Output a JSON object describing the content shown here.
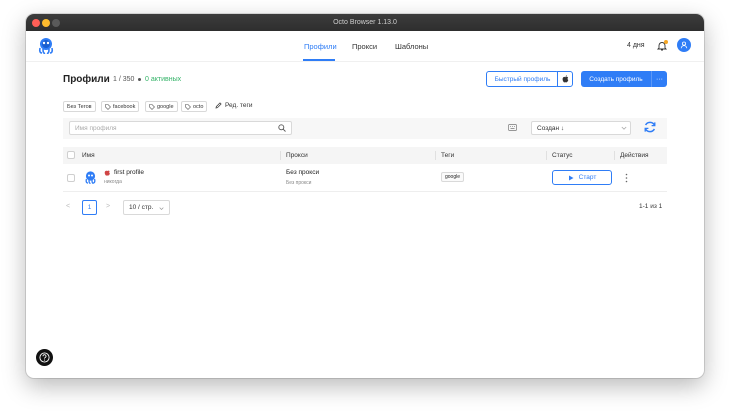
{
  "window": {
    "title": "Octo Browser 1.13.0"
  },
  "nav": {
    "profiles": "Профили",
    "proxies": "Прокси",
    "templates": "Шаблоны"
  },
  "header": {
    "days_left": "4 дня"
  },
  "page": {
    "title": "Профили",
    "count": "1 / 350",
    "active": "0 активных",
    "quick_profile": "Быстрый профиль",
    "create_profile": "Создать профиль",
    "more": "···"
  },
  "tags": {
    "items": [
      "Без Тегов",
      "facebook",
      "google",
      "octo"
    ],
    "edit_label": "Ред. теги"
  },
  "toolbar": {
    "search_placeholder": "Имя профиля",
    "sort_label": "Создан ↓"
  },
  "table": {
    "headers": [
      "Имя",
      "Прокси",
      "Теги",
      "Статус",
      "Действия"
    ],
    "rows": [
      {
        "name": "first profile",
        "sub": "никогда",
        "proxy": "Без прокси",
        "proxy_sub": "Без прокси",
        "tag": "google",
        "action": "Старт"
      }
    ]
  },
  "pagination": {
    "prev": "<",
    "current": "1",
    "next": ">",
    "page_size": "10 / стр.",
    "total": "1-1 из 1"
  },
  "colors": {
    "accent": "#2f7df6",
    "active": "#34b368"
  },
  "icons": [
    "octopus-logo-icon",
    "bell-icon",
    "user-icon",
    "apple-icon",
    "tag-icon",
    "pencil-icon",
    "search-icon",
    "keyboard-icon",
    "chevron-down-icon",
    "refresh-icon",
    "play-icon",
    "kebab-icon",
    "help-icon"
  ]
}
